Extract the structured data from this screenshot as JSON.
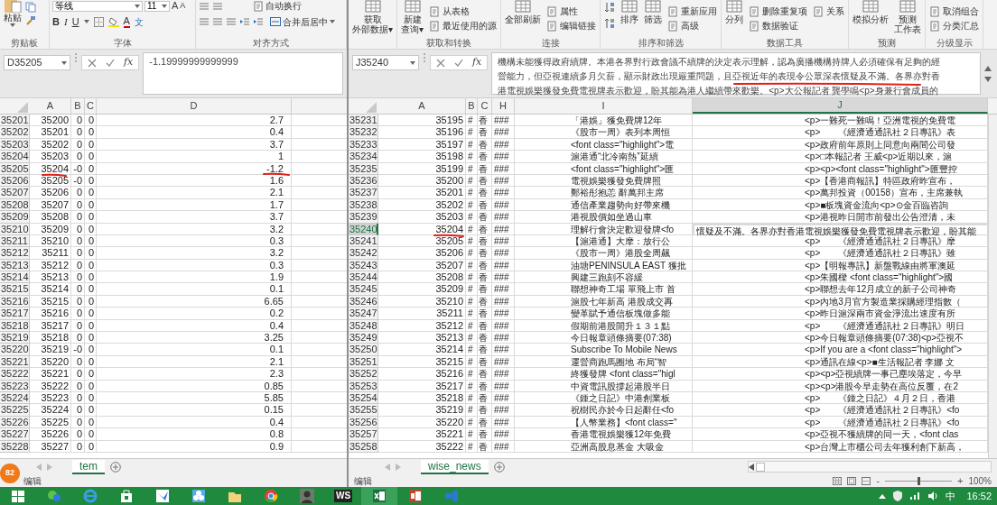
{
  "left_window": {
    "ribbon": {
      "paste_label": "粘贴",
      "font_name": "等线",
      "font_size": "11",
      "size_buttons": [
        "A",
        "A"
      ],
      "format_buttons": [
        "B",
        "I",
        "U"
      ],
      "font_color_label": "A",
      "phonetic_label": "文",
      "wrap_text_label": "自动换行",
      "merge_label": "合并后居中",
      "group_labels": [
        "剪贴板",
        "字体",
        "对齐方式"
      ]
    },
    "name_box": "D35205",
    "fx_label": "fx",
    "formula": "-1.19999999999999",
    "columns": [
      "A",
      "B",
      "C",
      "D"
    ],
    "rows": [
      {
        "row": "35201",
        "a": "35200",
        "b": "0",
        "c": "0",
        "d": "2.7",
        "marked": false
      },
      {
        "row": "35202",
        "a": "35201",
        "b": "0",
        "c": "0",
        "d": "0.4",
        "marked": false
      },
      {
        "row": "35203",
        "a": "35202",
        "b": "0",
        "c": "0",
        "d": "3.7",
        "marked": false
      },
      {
        "row": "35204",
        "a": "35203",
        "b": "0",
        "c": "0",
        "d": "1",
        "marked": false
      },
      {
        "row": "35205",
        "a": "35204",
        "b": "-0",
        "c": "0",
        "d": "-1.2",
        "marked": true
      },
      {
        "row": "35206",
        "a": "35205",
        "b": "-0",
        "c": "0",
        "d": "1.6",
        "marked": false
      },
      {
        "row": "35207",
        "a": "35206",
        "b": "0",
        "c": "0",
        "d": "2.1",
        "marked": false
      },
      {
        "row": "35208",
        "a": "35207",
        "b": "0",
        "c": "0",
        "d": "1.7",
        "marked": false
      },
      {
        "row": "35209",
        "a": "35208",
        "b": "0",
        "c": "0",
        "d": "3.7",
        "marked": false
      },
      {
        "row": "35210",
        "a": "35209",
        "b": "0",
        "c": "0",
        "d": "3.2",
        "marked": false
      },
      {
        "row": "35211",
        "a": "35210",
        "b": "0",
        "c": "0",
        "d": "0.3",
        "marked": false
      },
      {
        "row": "35212",
        "a": "35211",
        "b": "0",
        "c": "0",
        "d": "3.2",
        "marked": false
      },
      {
        "row": "35213",
        "a": "35212",
        "b": "0",
        "c": "0",
        "d": "0.3",
        "marked": false
      },
      {
        "row": "35214",
        "a": "35213",
        "b": "0",
        "c": "0",
        "d": "1.9",
        "marked": false
      },
      {
        "row": "35215",
        "a": "35214",
        "b": "0",
        "c": "0",
        "d": "0.1",
        "marked": false
      },
      {
        "row": "35216",
        "a": "35215",
        "b": "0",
        "c": "0",
        "d": "6.65",
        "marked": false
      },
      {
        "row": "35217",
        "a": "35216",
        "b": "0",
        "c": "0",
        "d": "0.2",
        "marked": false
      },
      {
        "row": "35218",
        "a": "35217",
        "b": "0",
        "c": "0",
        "d": "0.4",
        "marked": false
      },
      {
        "row": "35219",
        "a": "35218",
        "b": "0",
        "c": "0",
        "d": "3.25",
        "marked": false
      },
      {
        "row": "35220",
        "a": "35219",
        "b": "-0",
        "c": "0",
        "d": "0.1",
        "marked": false
      },
      {
        "row": "35221",
        "a": "35220",
        "b": "0",
        "c": "0",
        "d": "2.1",
        "marked": false
      },
      {
        "row": "35222",
        "a": "35221",
        "b": "0",
        "c": "0",
        "d": "2.3",
        "marked": false
      },
      {
        "row": "35223",
        "a": "35222",
        "b": "0",
        "c": "0",
        "d": "0.85",
        "marked": false
      },
      {
        "row": "35224",
        "a": "35223",
        "b": "0",
        "c": "0",
        "d": "5.85",
        "marked": false
      },
      {
        "row": "35225",
        "a": "35224",
        "b": "0",
        "c": "0",
        "d": "0.15",
        "marked": false
      },
      {
        "row": "35226",
        "a": "35225",
        "b": "0",
        "c": "0",
        "d": "0.4",
        "marked": false
      },
      {
        "row": "35227",
        "a": "35226",
        "b": "0",
        "c": "0",
        "d": "0.8",
        "marked": false
      },
      {
        "row": "35228",
        "a": "35227",
        "b": "0",
        "c": "0",
        "d": "0.9",
        "marked": false
      }
    ],
    "sheet_tabs": [
      {
        "label": "tem",
        "selected": true
      }
    ],
    "notification_badge": "82",
    "status": "编辑"
  },
  "right_window": {
    "ribbon": {
      "groups": [
        {
          "items": [
            {
              "kind": "large",
              "lines": [
                "获取",
                "外部数据▾"
              ]
            }
          ]
        },
        {
          "label": "获取和转换",
          "items": [
            {
              "kind": "large",
              "lines": [
                "新建",
                "查询▾"
              ]
            },
            {
              "kind": "small",
              "label": "从表格"
            },
            {
              "kind": "small",
              "label": "最近使用的源"
            }
          ]
        },
        {
          "label": "连接",
          "items": [
            {
              "kind": "large",
              "lines": [
                "全部刷新"
              ]
            },
            {
              "kind": "small",
              "label": "属性"
            },
            {
              "kind": "small",
              "label": "编辑链接"
            }
          ]
        },
        {
          "label": "排序和筛选",
          "items": [
            {
              "kind": "sort"
            },
            {
              "kind": "large",
              "lines": [
                "排序"
              ]
            },
            {
              "kind": "large",
              "lines": [
                "筛选"
              ]
            },
            {
              "kind": "small",
              "label": "重新应用"
            },
            {
              "kind": "small",
              "label": "高级"
            }
          ]
        },
        {
          "label": "数据工具",
          "items": [
            {
              "kind": "large",
              "lines": [
                "分列"
              ]
            },
            {
              "kind": "small",
              "label": "删除重复项"
            },
            {
              "kind": "small",
              "label": "数据验证"
            },
            {
              "kind": "small",
              "label": "关系"
            }
          ]
        },
        {
          "label": "预测",
          "items": [
            {
              "kind": "large",
              "lines": [
                "模拟分析"
              ]
            },
            {
              "kind": "large",
              "lines": [
                "预测",
                "工作表"
              ]
            }
          ]
        },
        {
          "label": "分级显示",
          "items": [
            {
              "kind": "small",
              "label": "取消组合"
            },
            {
              "kind": "small",
              "label": "分类汇总"
            }
          ]
        }
      ]
    },
    "name_box": "J35240",
    "fx_label": "fx",
    "formula_lines": [
      "機構未能獲得政府續牌。本港各界對行政會議不續牌的決定表示理解，認為廣播機構持牌人必須確保有足夠的經",
      "營能力，但亞視連續多月欠薪，顯示財政出現嚴重問題，且亞視近年的表現令公眾深表懷疑及不滿。各界亦對香",
      "港電視娛樂獲發免費電視牌表示歡迎，盼其能為港人繼續帶來歡樂。<p>大公報記者 龔學鳴<p>身兼行會成員的"
    ],
    "columns": [
      "A",
      "B",
      "C",
      "H",
      "I",
      "J"
    ],
    "rows": [
      {
        "row": "35231",
        "a": "35195",
        "b": "#",
        "c": "香",
        "h": "###",
        "i": "「港娛」獲免費牌12年",
        "j": "<p>一難死一難鳴！亞洲電視的免費電",
        "selected": false,
        "marked": false
      },
      {
        "row": "35232",
        "a": "35196",
        "b": "#",
        "c": "香",
        "h": "###",
        "i": "《股市一周》表列本周恒",
        "j": "<p>　　《經濟通通訊社２日專訊》表",
        "selected": false,
        "marked": false
      },
      {
        "row": "35233",
        "a": "35197",
        "b": "#",
        "c": "香",
        "h": "###",
        "i": "<font class=\"highlight\">電",
        "j": "<p>政府前年原則上同意向兩間公司發",
        "selected": false,
        "marked": false
      },
      {
        "row": "35234",
        "a": "35198",
        "b": "#",
        "c": "香",
        "h": "###",
        "i": "滬港通“北冷南熱”延續",
        "j": "<p>□本報記者 王威<p>近期以來，滬",
        "selected": false,
        "marked": false
      },
      {
        "row": "35235",
        "a": "35199",
        "b": "#",
        "c": "香",
        "h": "###",
        "i": "<font class=\"highlight\">匯",
        "j": "<p><p><font class=\"highlight\">匯豐控",
        "selected": false,
        "marked": false
      },
      {
        "row": "35236",
        "a": "35200",
        "b": "#",
        "c": "香",
        "h": "###",
        "i": "電視娛樂獲發免費牌照",
        "j": "<p>【香港商報訊】特區政府昨宣布，",
        "selected": false,
        "marked": false
      },
      {
        "row": "35237",
        "a": "35201",
        "b": "#",
        "c": "香",
        "h": "###",
        "i": "鄭裕彤抱恙 辭萬邦主席",
        "j": "<p>萬邦投資（00158）宣布，主席兼執",
        "selected": false,
        "marked": false
      },
      {
        "row": "35238",
        "a": "35202",
        "b": "#",
        "c": "香",
        "h": "###",
        "i": "通信產業趨勢向好帶來機",
        "j": "<p>■板塊資金流向<p>⊙金百臨咨詢",
        "selected": false,
        "marked": false
      },
      {
        "row": "35239",
        "a": "35203",
        "b": "#",
        "c": "香",
        "h": "###",
        "i": "港視股價如坐過山車",
        "j": "<p>港視昨日開市前發出公告澄清，未",
        "selected": false,
        "marked": false
      },
      {
        "row": "35240",
        "a": "35204",
        "b": "#",
        "c": "香",
        "h": "###",
        "i": "理解行會決定歡迎發牌<fo",
        "j": "懷疑及不滿。各界亦對香港電視娛樂獲發免費電視牌表示歡迎，盼其能",
        "selected": true,
        "marked": true
      },
      {
        "row": "35241",
        "a": "35205",
        "b": "#",
        "c": "香",
        "h": "###",
        "i": "【滬港通】大摩：放行公",
        "j": "<p>　　《經濟通通訊社２日專訊》摩",
        "selected": false,
        "marked": false
      },
      {
        "row": "35242",
        "a": "35206",
        "b": "#",
        "c": "香",
        "h": "###",
        "i": "《股市一周》港股全周飆",
        "j": "<p>　　《經濟通通訊社２日專訊》雖",
        "selected": false,
        "marked": false
      },
      {
        "row": "35243",
        "a": "35207",
        "b": "#",
        "c": "香",
        "h": "###",
        "i": "油塘PENINSULA EAST 獲批",
        "j": "<p>【明報專訊】新盤戰線由將軍澳延",
        "selected": false,
        "marked": false
      },
      {
        "row": "35244",
        "a": "35208",
        "b": "#",
        "c": "香",
        "h": "###",
        "i": "興建三跑刻不容緩",
        "j": "<p>朱國樑 <font class=\"highlight\">國",
        "selected": false,
        "marked": false
      },
      {
        "row": "35245",
        "a": "35209",
        "b": "#",
        "c": "香",
        "h": "###",
        "i": "聯想神奇工場 單飛上市 首",
        "j": "<p>聯想去年12月成立的新子公司神奇",
        "selected": false,
        "marked": false
      },
      {
        "row": "35246",
        "a": "35210",
        "b": "#",
        "c": "香",
        "h": "###",
        "i": "滬股七年新高 港股成交再",
        "j": "<p>內地3月官方製造業採購經理指數（",
        "selected": false,
        "marked": false
      },
      {
        "row": "35247",
        "a": "35211",
        "b": "#",
        "c": "香",
        "h": "###",
        "i": "變革賦予通信板塊做多能",
        "j": "<p>昨日滬深兩市資金淨流出速度有所",
        "selected": false,
        "marked": false
      },
      {
        "row": "35248",
        "a": "35212",
        "b": "#",
        "c": "香",
        "h": "###",
        "i": "假期前港股開升１３１點",
        "j": "<p>　　《經濟通通訊社２日專訊》明日",
        "selected": false,
        "marked": false
      },
      {
        "row": "35249",
        "a": "35213",
        "b": "#",
        "c": "香",
        "h": "###",
        "i": "今日報章頭條摘要(07:38)",
        "j": "<p>今日報章頭條摘要(07:38)<p>亞視不",
        "selected": false,
        "marked": false
      },
      {
        "row": "35250",
        "a": "35214",
        "b": "#",
        "c": "香",
        "h": "###",
        "i": "Subscribe To Mobile News",
        "j": "<p>If you are a <font class=\"highlight\">",
        "selected": false,
        "marked": false
      },
      {
        "row": "35251",
        "a": "35215",
        "b": "#",
        "c": "香",
        "h": "###",
        "i": "運營商跑馬圈地 布局“智",
        "j": "<p>通訊在線<p>■生活報記者 李娜 文",
        "selected": false,
        "marked": false
      },
      {
        "row": "35252",
        "a": "35216",
        "b": "#",
        "c": "香",
        "h": "###",
        "i": "終獲發牌 <font class=\"higl",
        "j": "<p><p>亞視續牌一事已塵埃落定，今早",
        "selected": false,
        "marked": false
      },
      {
        "row": "35253",
        "a": "35217",
        "b": "#",
        "c": "香",
        "h": "###",
        "i": "中資電訊股撐起港股半日",
        "j": "<p><p>港股今早走勢在高位反覆，在2",
        "selected": false,
        "marked": false
      },
      {
        "row": "35254",
        "a": "35218",
        "b": "#",
        "c": "香",
        "h": "###",
        "i": "《鍾之日記》中港創業板",
        "j": "<p>　　《鍾之日記》４月２日，香港",
        "selected": false,
        "marked": false
      },
      {
        "row": "35255",
        "a": "35219",
        "b": "#",
        "c": "香",
        "h": "###",
        "i": "祝樹民亦於今日起辭任<fo",
        "j": "<p>　　《經濟通通訊社２日專訊》<fo",
        "selected": false,
        "marked": false
      },
      {
        "row": "35256",
        "a": "35220",
        "b": "#",
        "c": "香",
        "h": "###",
        "i": "【人幣業務】<font class=\"",
        "j": "<p>　　《經濟通通訊社２日專訊》<fo",
        "selected": false,
        "marked": false
      },
      {
        "row": "35257",
        "a": "35221",
        "b": "#",
        "c": "香",
        "h": "###",
        "i": "香港電視娛樂獲12年免費",
        "j": "<p>亞視不獲續牌的同一天，<font clas",
        "selected": false,
        "marked": false
      },
      {
        "row": "35258",
        "a": "35222",
        "b": "#",
        "c": "香",
        "h": "###",
        "i": "亞洲高股息基金 大吸金",
        "j": "<p>台灣上市櫃公司去年獲利創下新高，",
        "selected": false,
        "marked": false
      }
    ],
    "sheet_tabs": [
      {
        "label": "wise_news",
        "selected": true
      }
    ],
    "status": "编辑",
    "zoom_minus": "-",
    "zoom_plus": "+",
    "zoom_slider": {
      "level": 0.5
    },
    "zoom_label": "100%"
  },
  "taskbar": {
    "apps": [
      {
        "kind": "start",
        "active": false
      },
      {
        "kind": "chat",
        "active": false
      },
      {
        "kind": "browser",
        "active": false
      },
      {
        "kind": "store",
        "active": false
      },
      {
        "kind": "mail",
        "active": false
      },
      {
        "kind": "cloud",
        "active": false
      },
      {
        "kind": "folder",
        "active": false
      },
      {
        "kind": "chrome",
        "active": false
      },
      {
        "kind": "figure",
        "active": false
      },
      {
        "kind": "ws",
        "label": "WS",
        "active": false
      },
      {
        "kind": "spreadsheet",
        "active": true
      },
      {
        "kind": "slides",
        "active": false
      },
      {
        "kind": "code",
        "active": false
      }
    ],
    "ime": "中",
    "time": "16:52"
  }
}
